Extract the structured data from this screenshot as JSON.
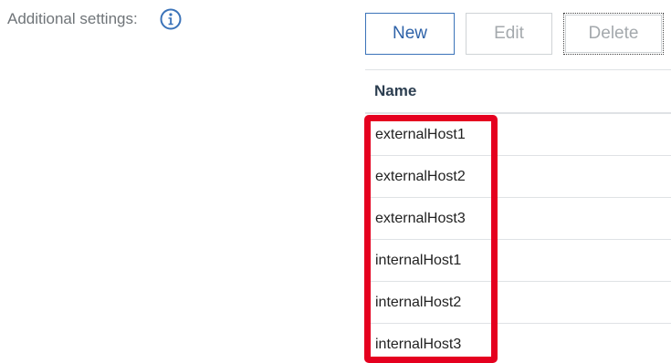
{
  "settings": {
    "label": "Additional settings:",
    "info_icon": "info-circle-icon"
  },
  "toolbar": {
    "new_label": "New",
    "edit_label": "Edit",
    "delete_label": "Delete"
  },
  "table": {
    "header_name": "Name",
    "rows": [
      "externalHost1",
      "externalHost2",
      "externalHost3",
      "internalHost1",
      "internalHost2",
      "internalHost3"
    ]
  },
  "colors": {
    "accent": "#3b73b9",
    "highlight": "#e5001f",
    "disabled_text": "#a4a9ad"
  }
}
